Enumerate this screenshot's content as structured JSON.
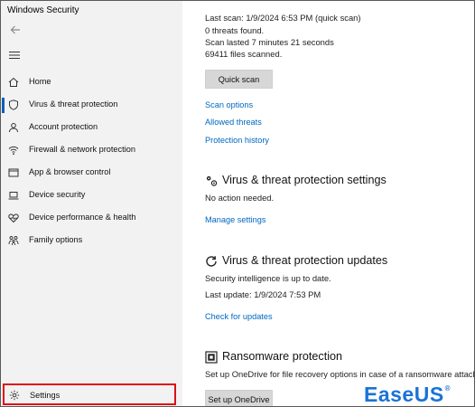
{
  "window": {
    "title": "Windows Security"
  },
  "sidebar": {
    "items": [
      {
        "label": "Home",
        "icon": "home-icon",
        "active": false
      },
      {
        "label": "Virus & threat protection",
        "icon": "shield-icon",
        "active": true
      },
      {
        "label": "Account protection",
        "icon": "person-icon",
        "active": false
      },
      {
        "label": "Firewall & network protection",
        "icon": "wifi-icon",
        "active": false
      },
      {
        "label": "App & browser control",
        "icon": "app-window-icon",
        "active": false
      },
      {
        "label": "Device security",
        "icon": "laptop-icon",
        "active": false
      },
      {
        "label": "Device performance & health",
        "icon": "heart-icon",
        "active": false
      },
      {
        "label": "Family options",
        "icon": "family-icon",
        "active": false
      }
    ],
    "settings": {
      "label": "Settings",
      "icon": "gear-icon"
    }
  },
  "scan": {
    "last_scan": "Last scan: 1/9/2024 6:53 PM (quick scan)",
    "threats_found": "0 threats found.",
    "duration": "Scan lasted 7 minutes 21 seconds",
    "files_scanned": "69411 files scanned.",
    "quick_scan_button": "Quick scan",
    "links": [
      "Scan options",
      "Allowed threats",
      "Protection history"
    ]
  },
  "settings_section": {
    "title": "Virus & threat protection settings",
    "status": "No action needed.",
    "link": "Manage settings"
  },
  "updates_section": {
    "title": "Virus & threat protection updates",
    "status": "Security intelligence is up to date.",
    "last_update": "Last update: 1/9/2024 7:53 PM",
    "link": "Check for updates"
  },
  "ransomware_section": {
    "title": "Ransomware protection",
    "description": "Set up OneDrive for file recovery options in case of a ransomware attack.",
    "button": "Set up OneDrive"
  },
  "watermark": {
    "text": "EaseUS",
    "mark": "®"
  },
  "colors": {
    "link": "#0067c0",
    "accent": "#005fb8",
    "highlight": "#e01010",
    "watermark": "#1a73d6"
  }
}
